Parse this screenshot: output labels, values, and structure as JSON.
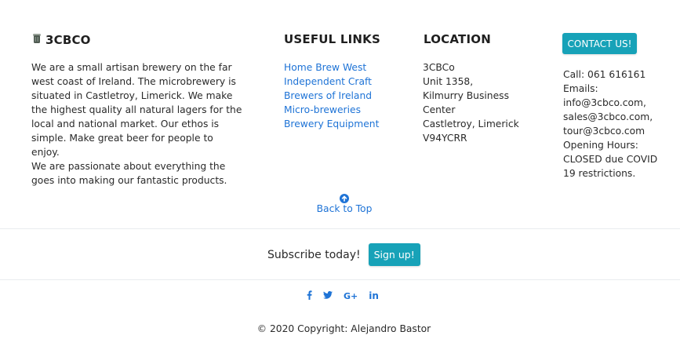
{
  "brand": {
    "icon": "beer-mug-icon",
    "name": "3CBCO"
  },
  "about": {
    "lines": [
      "We are a small artisan brewery on the far",
      "west coast of Ireland. The microbrewery is",
      "situated in Castletroy, Limerick. We make",
      "the highest quality all natural lagers for the",
      "local and national market. Our ethos is",
      "simple. Make great beer for people to enjoy.",
      "We are passionate about everything the",
      "goes into making our fantastic products."
    ]
  },
  "useful_links": {
    "title": "USEFUL LINKS",
    "items": [
      "Home Brew West",
      "Independent Craft",
      "Brewers of Ireland",
      "Micro-breweries",
      "Brewery Equipment"
    ]
  },
  "location": {
    "title": "LOCATION",
    "lines": [
      "3CBCo",
      "Unit 1358,",
      "Kilmurry Business",
      "Center",
      "Castletroy, Limerick",
      "V94YCRR"
    ]
  },
  "contact": {
    "button": "CONTACT US!",
    "lines": [
      "Call: 061 616161",
      "Emails:",
      "info@3cbco.com,",
      "sales@3cbco.com,",
      "tour@3cbco.com",
      "Opening Hours:",
      "CLOSED due COVID",
      "19 restrictions."
    ]
  },
  "back_to_top": {
    "icon": "arrow-up-circle-icon",
    "label": "Back to Top"
  },
  "subscribe": {
    "text": "Subscribe today!",
    "button": "Sign up!"
  },
  "social": [
    "facebook-icon",
    "twitter-icon",
    "google-plus-icon",
    "linkedin-icon"
  ],
  "copyright": "© 2020 Copyright: Alejandro Bastor",
  "colors": {
    "accent": "#17a2b8",
    "link": "#1e73d6",
    "divider": "#e9ecef"
  }
}
